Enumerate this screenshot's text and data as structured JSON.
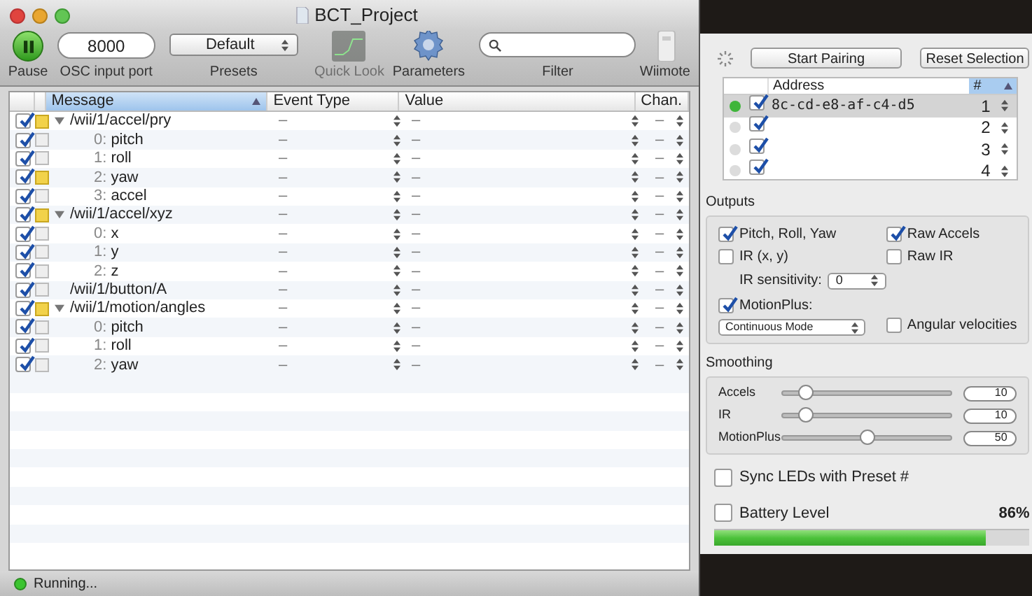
{
  "window": {
    "title": "BCT_Project"
  },
  "toolbar": {
    "pause": {
      "label": "Pause"
    },
    "port": {
      "value": "8000",
      "label": "OSC input port"
    },
    "presets": {
      "value": "Default",
      "label": "Presets"
    },
    "quick_look": {
      "label": "Quick Look",
      "disabled": true
    },
    "parameters": {
      "label": "Parameters"
    },
    "filter": {
      "label": "Filter"
    },
    "wiimote": {
      "label": "Wiimote"
    }
  },
  "table": {
    "columns": [
      {
        "label": "Message",
        "sorted": true
      },
      {
        "label": "Event Type",
        "sorted": false
      },
      {
        "label": "Value",
        "sorted": false
      },
      {
        "label": "Chan.",
        "sorted": false
      }
    ],
    "rows": [
      {
        "message": "/wii/1/accel/pry",
        "enabled": true,
        "flagged": true,
        "expanded": true,
        "event_type": "–",
        "value": "–",
        "channel": "–",
        "children": [
          {
            "index": "0:",
            "message": "pitch",
            "enabled": true,
            "flagged": false,
            "event_type": "–",
            "value": "–",
            "channel": "–"
          },
          {
            "index": "1:",
            "message": "roll",
            "enabled": true,
            "flagged": false,
            "event_type": "–",
            "value": "–",
            "channel": "–"
          },
          {
            "index": "2:",
            "message": "yaw",
            "enabled": true,
            "flagged": true,
            "event_type": "–",
            "value": "–",
            "channel": "–"
          },
          {
            "index": "3:",
            "message": "accel",
            "enabled": true,
            "flagged": false,
            "event_type": "–",
            "value": "–",
            "channel": "–"
          }
        ]
      },
      {
        "message": "/wii/1/accel/xyz",
        "enabled": true,
        "flagged": true,
        "expanded": true,
        "event_type": "–",
        "value": "–",
        "channel": "–",
        "children": [
          {
            "index": "0:",
            "message": "x",
            "enabled": true,
            "flagged": false,
            "event_type": "–",
            "value": "–",
            "channel": "–"
          },
          {
            "index": "1:",
            "message": "y",
            "enabled": true,
            "flagged": false,
            "event_type": "–",
            "value": "–",
            "channel": "–"
          },
          {
            "index": "2:",
            "message": "z",
            "enabled": true,
            "flagged": false,
            "event_type": "–",
            "value": "–",
            "channel": "–"
          }
        ]
      },
      {
        "message": "/wii/1/button/A",
        "enabled": true,
        "flagged": false,
        "event_type": "–",
        "value": "–",
        "channel": "–"
      },
      {
        "message": "/wii/1/motion/angles",
        "enabled": true,
        "flagged": true,
        "expanded": true,
        "event_type": "–",
        "value": "–",
        "channel": "–",
        "children": [
          {
            "index": "0:",
            "message": "pitch",
            "enabled": true,
            "flagged": false,
            "event_type": "–",
            "value": "–",
            "channel": "–"
          },
          {
            "index": "1:",
            "message": "roll",
            "enabled": true,
            "flagged": false,
            "event_type": "–",
            "value": "–",
            "channel": "–"
          },
          {
            "index": "2:",
            "message": "yaw",
            "enabled": true,
            "flagged": false,
            "event_type": "–",
            "value": "–",
            "channel": "–"
          }
        ]
      }
    ]
  },
  "status_bar": {
    "text": "Running..."
  },
  "pairing": {
    "start_button": "Start Pairing",
    "reset_button": "Reset Selection"
  },
  "devices": {
    "columns": [
      {
        "label": "Address",
        "sorted": false
      },
      {
        "label": "#",
        "sorted": true
      }
    ],
    "rows": [
      {
        "connected": true,
        "enabled": true,
        "address": "8c-cd-e8-af-c4-d5",
        "number": "1",
        "selected": true
      },
      {
        "connected": false,
        "enabled": true,
        "number": "2",
        "selected": false
      },
      {
        "connected": false,
        "enabled": true,
        "number": "3",
        "selected": false
      },
      {
        "connected": false,
        "enabled": true,
        "number": "4",
        "selected": false
      }
    ]
  },
  "outputs": {
    "title": "Outputs",
    "pitch_roll_yaw": {
      "label": "Pitch, Roll, Yaw",
      "checked": true
    },
    "raw_accels": {
      "label": "Raw Accels",
      "checked": true
    },
    "ir": {
      "label": "IR (x, y)",
      "checked": false
    },
    "raw_ir": {
      "label": "Raw IR",
      "checked": false
    },
    "ir_sensitivity": {
      "label": "IR sensitivity:",
      "value": "0"
    },
    "motionplus": {
      "label": "MotionPlus:",
      "checked": true
    },
    "motion_mode": {
      "value": "Continuous Mode"
    },
    "angular_velocities": {
      "label": "Angular velocities",
      "checked": false
    }
  },
  "smoothing": {
    "title": "Smoothing",
    "sliders": [
      {
        "label": "Accels",
        "level": 0.13,
        "value": "10"
      },
      {
        "label": "IR",
        "level": 0.13,
        "value": "10"
      },
      {
        "label": "MotionPlus",
        "level": 0.5,
        "value": "50"
      }
    ]
  },
  "sync_leds": {
    "label": "Sync LEDs with Preset #",
    "checked": false
  },
  "battery": {
    "label": "Battery Level",
    "checked": false,
    "reading": "86%",
    "level": 0.86
  }
}
